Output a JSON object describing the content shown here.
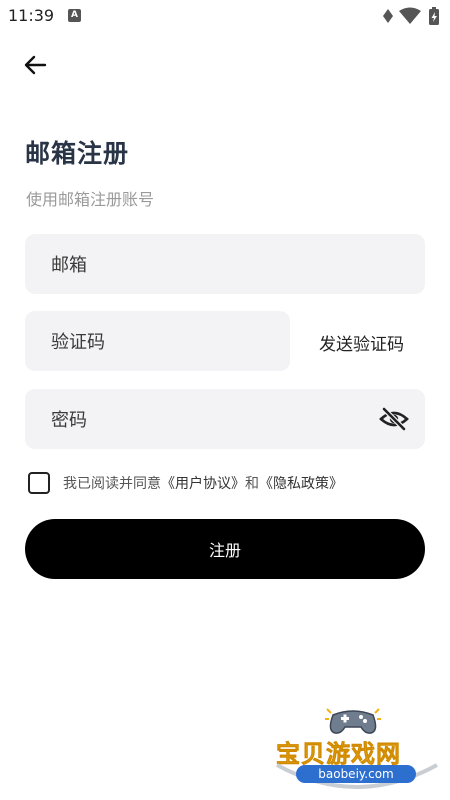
{
  "status_bar": {
    "time": "11:39",
    "notification_icon": "A"
  },
  "header": {
    "back_icon": "arrow-left-icon"
  },
  "title": "邮箱注册",
  "subtitle": "使用邮箱注册账号",
  "form": {
    "email_placeholder": "邮箱",
    "code_placeholder": "验证码",
    "send_code_label": "发送验证码",
    "password_placeholder": "密码",
    "password_visibility_icon": "eye-off-icon"
  },
  "agreement": {
    "checked": false,
    "prefix": "我已阅读并同意",
    "user_agreement": "《用户协议》",
    "and": "和",
    "privacy_policy": "《隐私政策》"
  },
  "submit_label": "注册",
  "watermark": {
    "name": "宝贝游戏网",
    "domain": "baobeiy.com"
  }
}
